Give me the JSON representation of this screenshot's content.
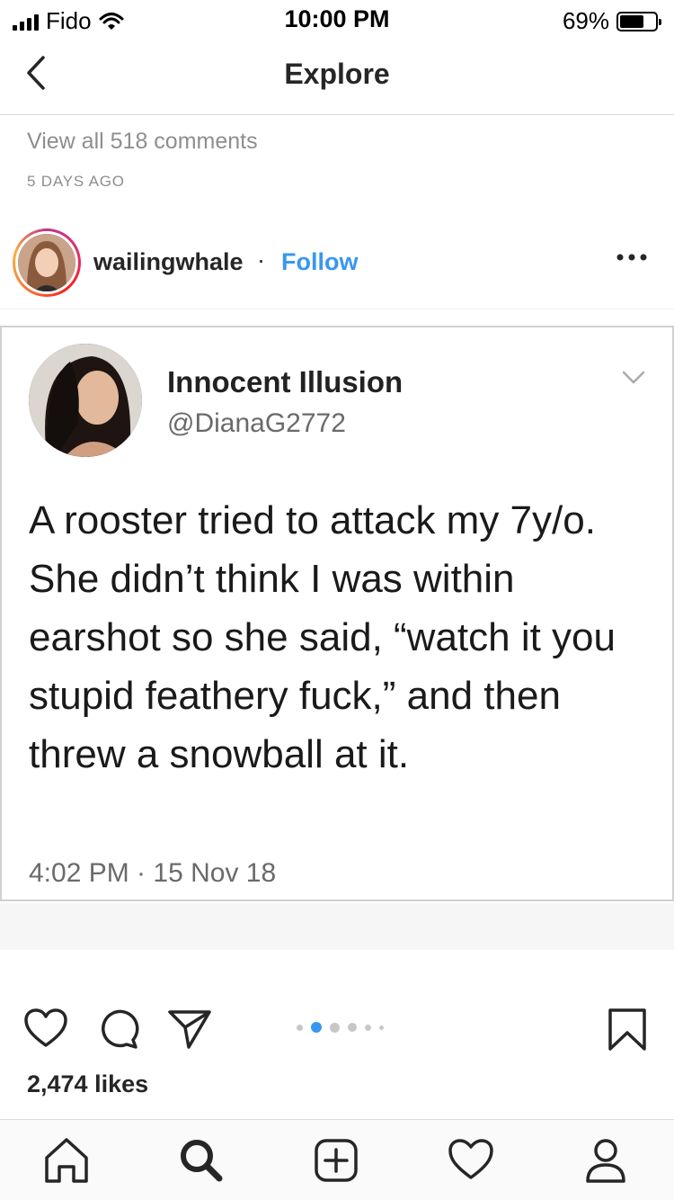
{
  "status_bar": {
    "carrier": "Fido",
    "time": "10:00 PM",
    "battery": "69%",
    "battery_level": 0.69
  },
  "nav": {
    "title": "Explore"
  },
  "comments": {
    "view_all": "View all 518 comments",
    "age": "5 DAYS AGO"
  },
  "post": {
    "username": "wailingwhale",
    "separator": "·",
    "follow_label": "Follow",
    "tweet": {
      "name": "Innocent Illusion",
      "handle": "@DianaG2772",
      "text": "A rooster tried to attack my 7y/o. She didn’t think I was within earshot so she said, “watch it you stupid feathery fuck,” and then threw a snowball at it.",
      "timestamp": "4:02 PM · 15 Nov 18"
    },
    "likes": "2,474 likes",
    "carousel": {
      "count": 6,
      "active_index": 1
    }
  },
  "colors": {
    "accent": "#3897f0",
    "text": "#262626",
    "muted": "#8e8e8e"
  },
  "icons": {
    "back": "chevron-left-icon",
    "more": "ellipsis-icon",
    "like": "heart-icon",
    "comment": "comment-icon",
    "share": "paper-plane-icon",
    "save": "bookmark-icon",
    "tabs": [
      "home-icon",
      "search-icon",
      "add-post-icon",
      "activity-heart-icon",
      "profile-icon"
    ]
  }
}
